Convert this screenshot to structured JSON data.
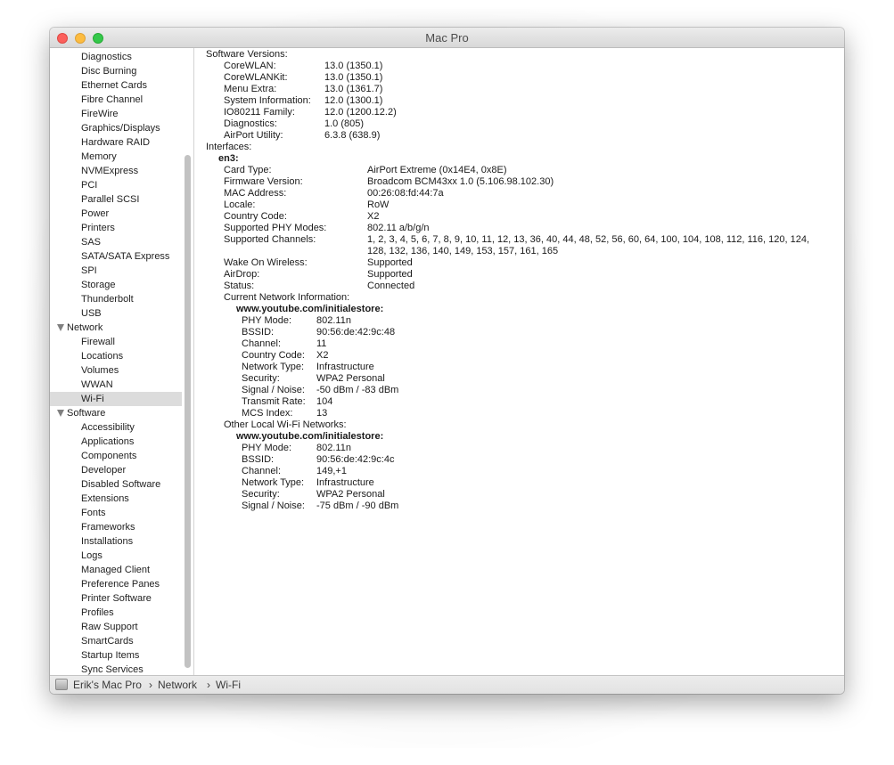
{
  "window": {
    "title": "Mac Pro"
  },
  "sidebar": {
    "items": [
      {
        "type": "item",
        "label": "Diagnostics"
      },
      {
        "type": "item",
        "label": "Disc Burning"
      },
      {
        "type": "item",
        "label": "Ethernet Cards"
      },
      {
        "type": "item",
        "label": "Fibre Channel"
      },
      {
        "type": "item",
        "label": "FireWire"
      },
      {
        "type": "item",
        "label": "Graphics/Displays"
      },
      {
        "type": "item",
        "label": "Hardware RAID"
      },
      {
        "type": "item",
        "label": "Memory"
      },
      {
        "type": "item",
        "label": "NVMExpress"
      },
      {
        "type": "item",
        "label": "PCI"
      },
      {
        "type": "item",
        "label": "Parallel SCSI"
      },
      {
        "type": "item",
        "label": "Power"
      },
      {
        "type": "item",
        "label": "Printers"
      },
      {
        "type": "item",
        "label": "SAS"
      },
      {
        "type": "item",
        "label": "SATA/SATA Express"
      },
      {
        "type": "item",
        "label": "SPI"
      },
      {
        "type": "item",
        "label": "Storage"
      },
      {
        "type": "item",
        "label": "Thunderbolt"
      },
      {
        "type": "item",
        "label": "USB"
      },
      {
        "type": "group",
        "label": "Network"
      },
      {
        "type": "item",
        "label": "Firewall"
      },
      {
        "type": "item",
        "label": "Locations"
      },
      {
        "type": "item",
        "label": "Volumes"
      },
      {
        "type": "item",
        "label": "WWAN"
      },
      {
        "type": "item",
        "label": "Wi-Fi",
        "selected": true
      },
      {
        "type": "group",
        "label": "Software"
      },
      {
        "type": "item",
        "label": "Accessibility"
      },
      {
        "type": "item",
        "label": "Applications"
      },
      {
        "type": "item",
        "label": "Components"
      },
      {
        "type": "item",
        "label": "Developer"
      },
      {
        "type": "item",
        "label": "Disabled Software"
      },
      {
        "type": "item",
        "label": "Extensions"
      },
      {
        "type": "item",
        "label": "Fonts"
      },
      {
        "type": "item",
        "label": "Frameworks"
      },
      {
        "type": "item",
        "label": "Installations"
      },
      {
        "type": "item",
        "label": "Logs"
      },
      {
        "type": "item",
        "label": "Managed Client"
      },
      {
        "type": "item",
        "label": "Preference Panes"
      },
      {
        "type": "item",
        "label": "Printer Software"
      },
      {
        "type": "item",
        "label": "Profiles"
      },
      {
        "type": "item",
        "label": "Raw Support"
      },
      {
        "type": "item",
        "label": "SmartCards"
      },
      {
        "type": "item",
        "label": "Startup Items"
      },
      {
        "type": "item",
        "label": "Sync Services"
      }
    ]
  },
  "content": {
    "software_versions_heading": "Software Versions:",
    "software_versions": [
      {
        "label": "CoreWLAN:",
        "value": "13.0 (1350.1)"
      },
      {
        "label": "CoreWLANKit:",
        "value": "13.0 (1350.1)"
      },
      {
        "label": "Menu Extra:",
        "value": "13.0 (1361.7)"
      },
      {
        "label": "System Information:",
        "value": "12.0 (1300.1)"
      },
      {
        "label": "IO80211 Family:",
        "value": "12.0 (1200.12.2)"
      },
      {
        "label": "Diagnostics:",
        "value": "1.0 (805)"
      },
      {
        "label": "AirPort Utility:",
        "value": "6.3.8 (638.9)"
      }
    ],
    "interfaces_heading": "Interfaces:",
    "interface_name": "en3:",
    "interface_props": [
      {
        "label": "Card Type:",
        "value": "AirPort Extreme  (0x14E4, 0x8E)"
      },
      {
        "label": "Firmware Version:",
        "value": "Broadcom BCM43xx 1.0 (5.106.98.102.30)"
      },
      {
        "label": "MAC Address:",
        "value": "00:26:08:fd:44:7a"
      },
      {
        "label": "Locale:",
        "value": "RoW"
      },
      {
        "label": "Country Code:",
        "value": "X2"
      },
      {
        "label": "Supported PHY Modes:",
        "value": "802.11 a/b/g/n"
      },
      {
        "label": "Supported Channels:",
        "value": "1, 2, 3, 4, 5, 6, 7, 8, 9, 10, 11, 12, 13, 36, 40, 44, 48, 52, 56, 60, 64, 100, 104, 108, 112, 116, 120, 124,",
        "value2": "128, 132, 136, 140, 149, 153, 157, 161, 165"
      },
      {
        "label": "Wake On Wireless:",
        "value": "Supported"
      },
      {
        "label": "AirDrop:",
        "value": "Supported"
      },
      {
        "label": "Status:",
        "value": "Connected"
      }
    ],
    "current_network_heading": "Current Network Information:",
    "current_network_name": "www.youtube.com/initialestore:",
    "current_network_props": [
      {
        "label": "PHY Mode:",
        "value": "802.11n"
      },
      {
        "label": "BSSID:",
        "value": "90:56:de:42:9c:48"
      },
      {
        "label": "Channel:",
        "value": "11"
      },
      {
        "label": "Country Code:",
        "value": "X2"
      },
      {
        "label": "Network Type:",
        "value": "Infrastructure"
      },
      {
        "label": "Security:",
        "value": "WPA2 Personal"
      },
      {
        "label": "Signal / Noise:",
        "value": "-50 dBm / -83 dBm"
      },
      {
        "label": "Transmit Rate:",
        "value": "104"
      },
      {
        "label": "MCS Index:",
        "value": "13"
      }
    ],
    "other_networks_heading": "Other Local Wi-Fi Networks:",
    "other_network_name": "www.youtube.com/initialestore:",
    "other_network_props": [
      {
        "label": "PHY Mode:",
        "value": "802.11n"
      },
      {
        "label": "BSSID:",
        "value": "90:56:de:42:9c:4c"
      },
      {
        "label": "Channel:",
        "value": "149,+1"
      },
      {
        "label": "Network Type:",
        "value": "Infrastructure"
      },
      {
        "label": "Security:",
        "value": "WPA2 Personal"
      },
      {
        "label": "Signal / Noise:",
        "value": "-75 dBm / -90 dBm"
      }
    ]
  },
  "statusbar": {
    "computer": "Erik's Mac Pro",
    "separator": "›",
    "section": "Network",
    "item": "Wi-Fi",
    "icon": "mac-pro-icon"
  }
}
